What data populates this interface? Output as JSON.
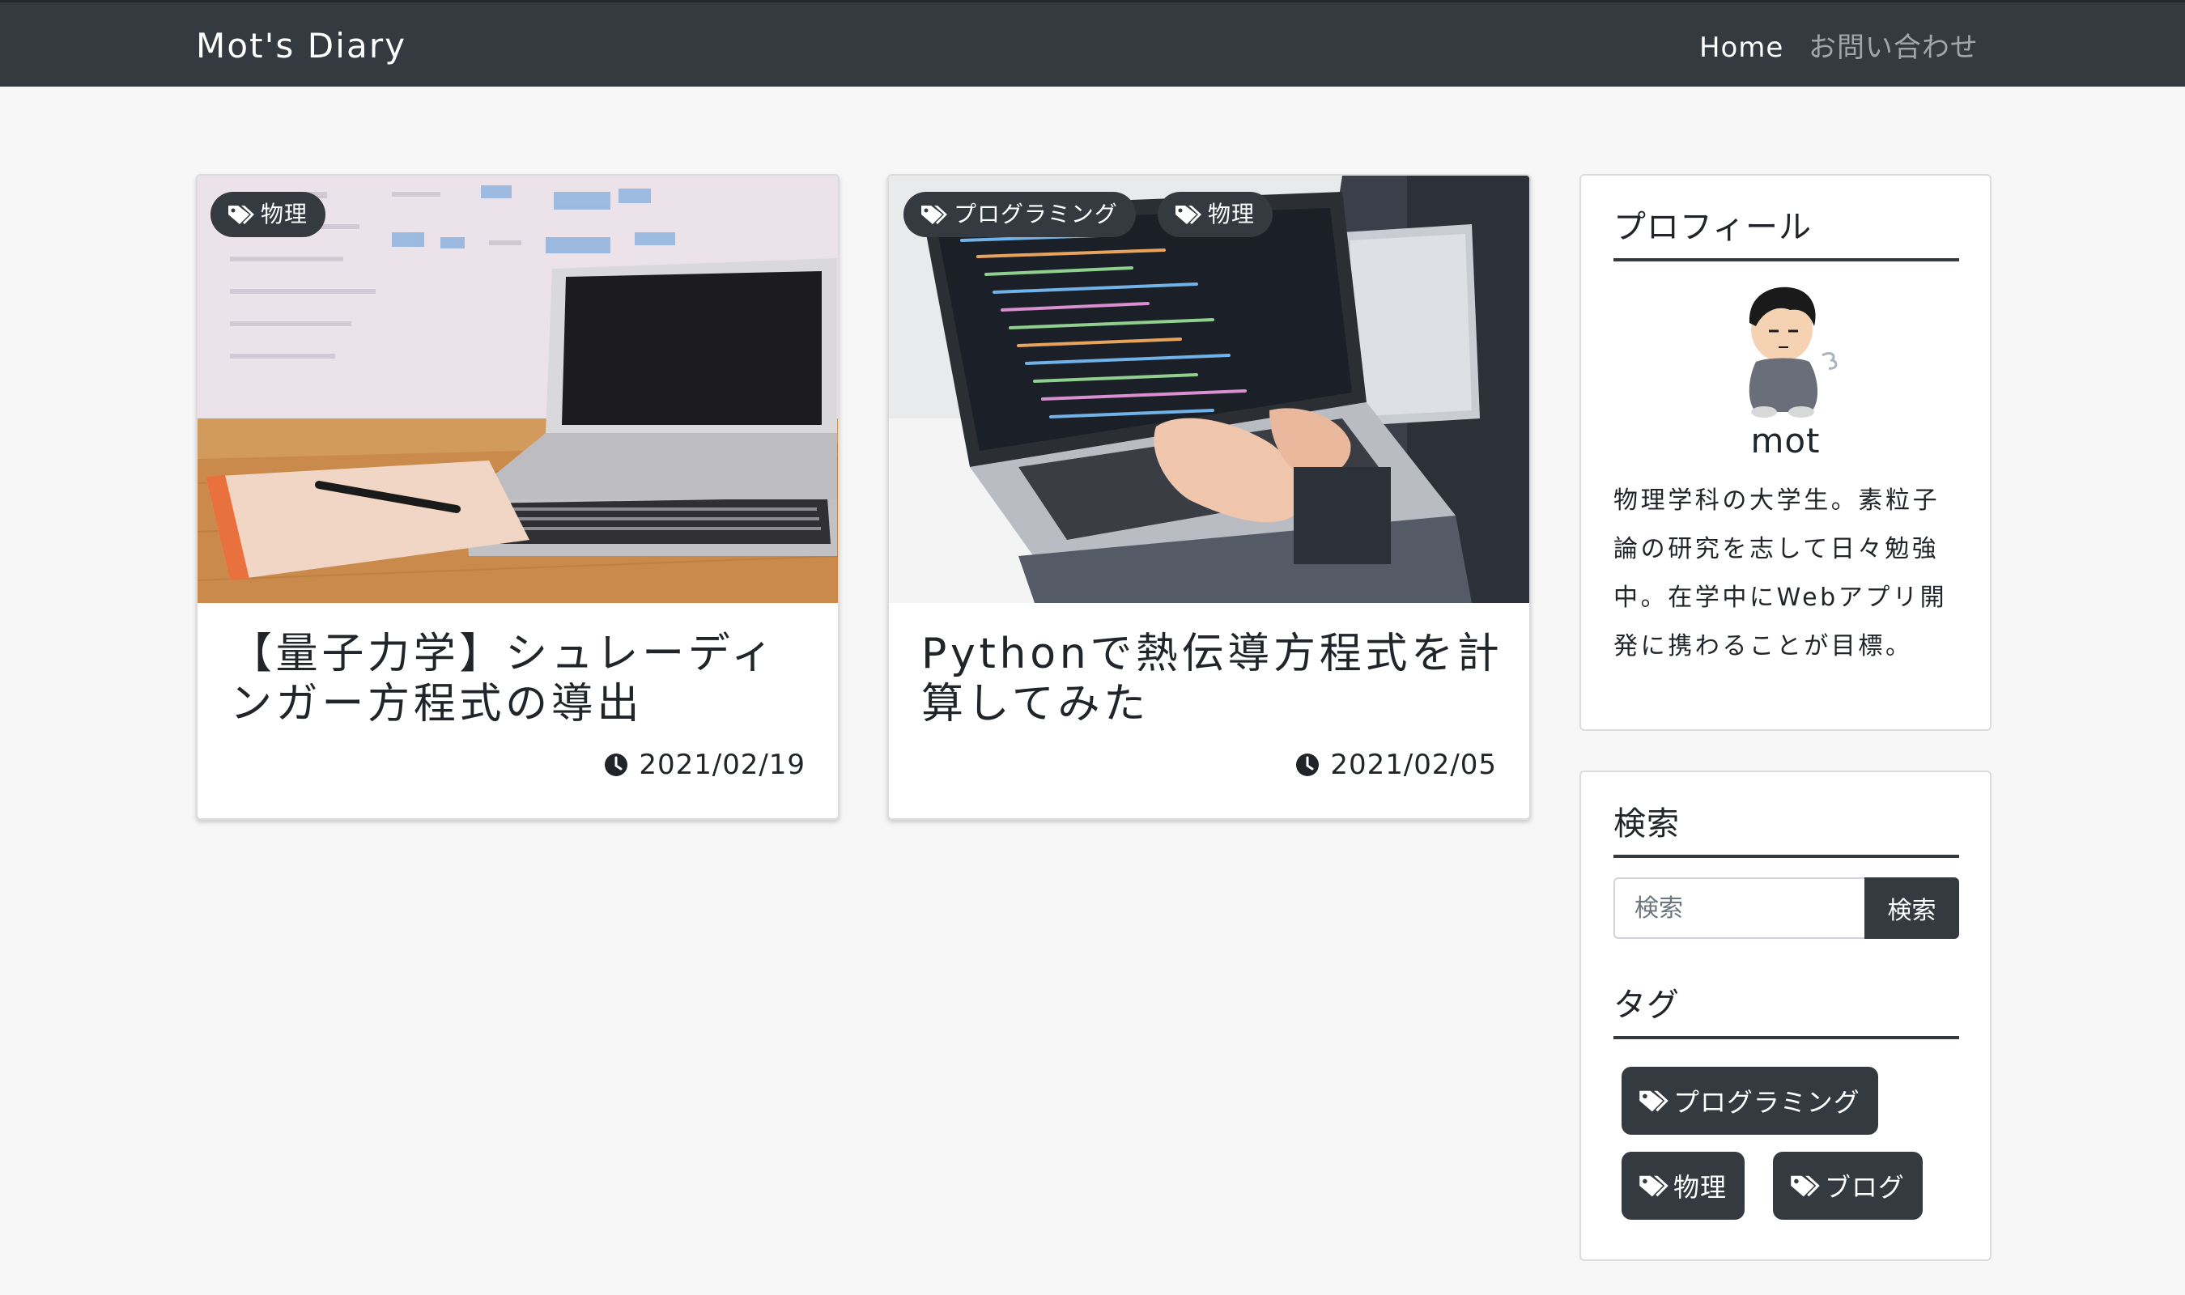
{
  "navbar": {
    "brand": "Mot's Diary",
    "links": [
      {
        "label": "Home",
        "active": true
      },
      {
        "label": "お問い合わせ",
        "active": false
      }
    ]
  },
  "posts": [
    {
      "tags": [
        "物理"
      ],
      "title": "【量子力学】シュレーディンガー方程式の導出",
      "date": "2021/02/19",
      "image": "laptop-notebook-desk"
    },
    {
      "tags": [
        "プログラミング",
        "物理"
      ],
      "title": "Pythonで熱伝導方程式を計算してみた",
      "date": "2021/02/05",
      "image": "typing-code-laptop"
    }
  ],
  "sidebar": {
    "profile": {
      "heading": "プロフィール",
      "name": "mot",
      "bio": "物理学科の大学生。素粒子論の研究を志して日々勉強中。在学中にWebアプリ開発に携わることが目標。"
    },
    "search": {
      "heading": "検索",
      "placeholder": "検索",
      "value": "",
      "button_label": "検索"
    },
    "tags": {
      "heading": "タグ",
      "items": [
        "プログラミング",
        "物理",
        "ブログ"
      ]
    }
  },
  "icons": {
    "tag": "tag-icon",
    "clock": "clock-icon"
  },
  "colors": {
    "dark": "#343a40",
    "background": "#f7f7f7"
  }
}
